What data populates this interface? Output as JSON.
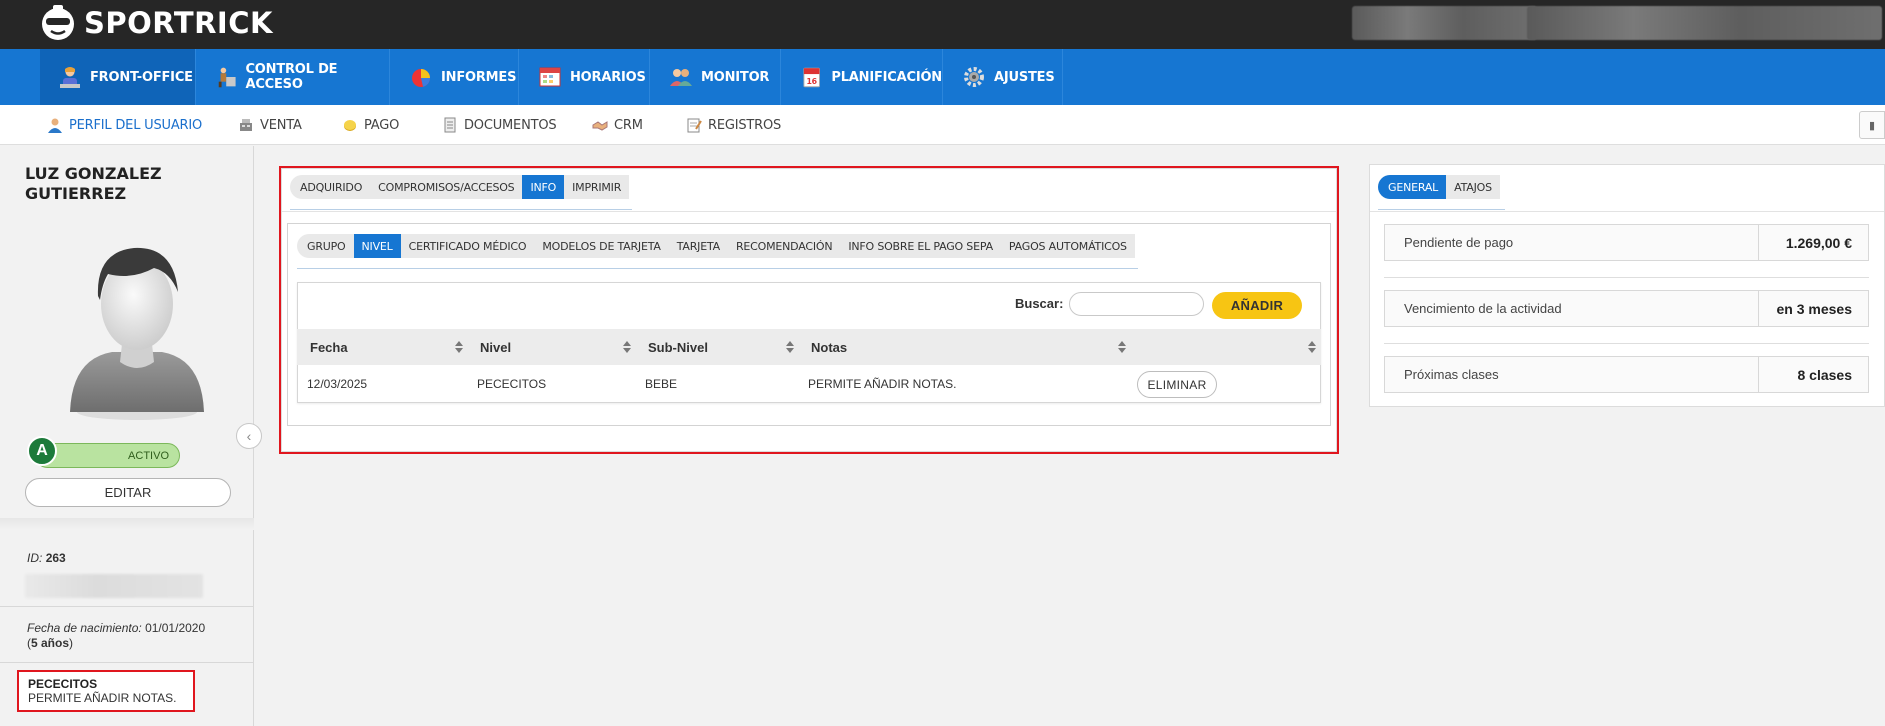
{
  "app": {
    "name": "SPORTRICK"
  },
  "mainnav": {
    "items": [
      {
        "label": "FRONT-OFFICE",
        "icon": "receptionist-icon",
        "active": true
      },
      {
        "label": "CONTROL DE ACCESO",
        "icon": "turnstile-icon"
      },
      {
        "label": "INFORMES",
        "icon": "pie-chart-icon"
      },
      {
        "label": "HORARIOS",
        "icon": "calendar-grid-icon"
      },
      {
        "label": "MONITOR",
        "icon": "users-icon"
      },
      {
        "label": "PLANIFICACIÓN",
        "icon": "calendar-icon"
      },
      {
        "label": "AJUSTES",
        "icon": "gear-icon"
      }
    ]
  },
  "subnav": {
    "items": [
      {
        "label": "PERFIL DEL USUARIO",
        "icon": "user-icon",
        "active": true
      },
      {
        "label": "VENTA",
        "icon": "cash-register-icon"
      },
      {
        "label": "PAGO",
        "icon": "coin-icon"
      },
      {
        "label": "DOCUMENTOS",
        "icon": "document-icon"
      },
      {
        "label": "CRM",
        "icon": "handshake-icon"
      },
      {
        "label": "REGISTROS",
        "icon": "notepad-icon"
      }
    ]
  },
  "profile": {
    "name": "LUZ GONZALEZ GUTIERREZ",
    "status_letter": "A",
    "status": "ACTIVO",
    "edit_label": "EDITAR",
    "id_label": "ID:",
    "id_value": "263",
    "dob_label": "Fecha de nacimiento:",
    "dob_value": "01/01/2020",
    "age_open": "(",
    "age": "5 años",
    "age_close": ")",
    "level_title": "PECECITOS",
    "level_note": "PERMITE AÑADIR NOTAS."
  },
  "main_tabs": [
    {
      "label": "ADQUIRIDO"
    },
    {
      "label": "COMPROMISOS/ACCESOS"
    },
    {
      "label": "INFO",
      "active": true
    },
    {
      "label": "IMPRIMIR"
    }
  ],
  "info_tabs": [
    {
      "label": "GRUPO"
    },
    {
      "label": "NIVEL",
      "active": true
    },
    {
      "label": "CERTIFICADO MÉDICO"
    },
    {
      "label": "MODELOS DE TARJETA"
    },
    {
      "label": "TARJETA"
    },
    {
      "label": "RECOMENDACIÓN"
    },
    {
      "label": "INFO SOBRE EL PAGO SEPA"
    },
    {
      "label": "PAGOS AUTOMÁTICOS"
    }
  ],
  "table": {
    "search_label": "Buscar:",
    "search_value": "",
    "add_label": "AÑADIR",
    "columns": [
      "Fecha",
      "Nivel",
      "Sub-Nivel",
      "Notas",
      ""
    ],
    "rows": [
      {
        "fecha": "12/03/2025",
        "nivel": "PECECITOS",
        "subnivel": "BEBE",
        "notas": "PERMITE AÑADIR NOTAS.",
        "action": "ELIMINAR"
      }
    ]
  },
  "right_tabs": [
    {
      "label": "GENERAL",
      "active": true
    },
    {
      "label": "ATAJOS"
    }
  ],
  "stats": [
    {
      "label": "Pendiente de pago",
      "value": "1.269,00 €"
    },
    {
      "label": "Vencimiento de la actividad",
      "value": "en 3 meses"
    },
    {
      "label": "Próximas clases",
      "value": "8 clases"
    }
  ],
  "colors": {
    "brand_blue": "#1676d2",
    "topbar": "#262626",
    "accent_yellow": "#f7c513",
    "highlight_red": "#e0161e",
    "active_green": "#b9e3a0"
  }
}
